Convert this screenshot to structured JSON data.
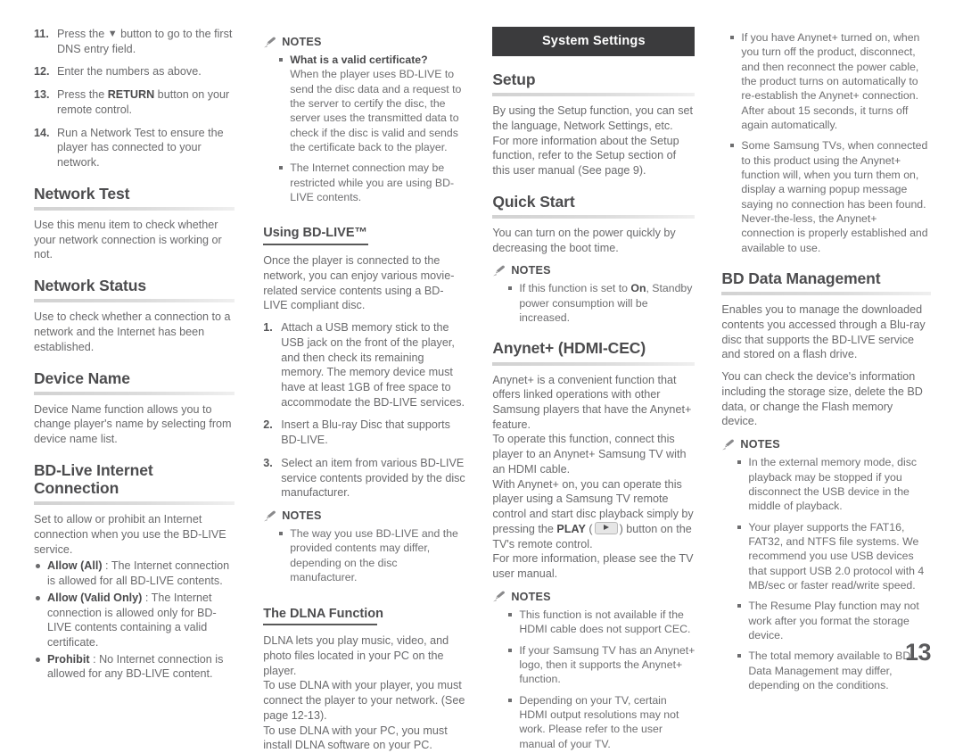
{
  "page": {
    "number": "13",
    "section_bar_label": "System Settings",
    "notes_label": "NOTES"
  },
  "column1": {
    "steps": [
      {
        "num": "11.",
        "text_before": "Press the ",
        "arrow": "▼",
        "text_after": " button to go to the first DNS entry field."
      },
      {
        "num": "12.",
        "text": "Enter the numbers as above."
      },
      {
        "num": "13.",
        "text_before": "Press the ",
        "bold": "RETURN",
        "text_after": " button on your remote control."
      },
      {
        "num": "14.",
        "text": "Run a Network Test to ensure the player has connected to your network."
      }
    ],
    "network_test": {
      "heading": "Network Test",
      "body": "Use this menu item to check whether your network connection is working or not."
    },
    "network_status": {
      "heading": "Network Status",
      "body": "Use to check whether a connection to a network and the Internet has been established."
    },
    "device_name": {
      "heading": "Device Name",
      "body": "Device Name function allows you to change player's name by selecting from device name list."
    },
    "bd_live": {
      "heading": "BD-Live Internet Connection",
      "body": "Set to allow or prohibit an Internet connection when you use the BD-LIVE service.",
      "options": [
        {
          "label": "Allow (All)",
          "text": " : The Internet connection is allowed for all BD-LIVE contents."
        },
        {
          "label": "Allow (Valid Only)",
          "text": " : The Internet connection is allowed only for BD-LIVE contents containing a valid certificate."
        },
        {
          "label": "Prohibit",
          "text": " : No Internet connection is allowed for any BD-LIVE content."
        }
      ]
    }
  },
  "column2": {
    "notes_top": [
      {
        "bold": "What is a valid certificate?",
        "text": "When the player uses BD-LIVE to send the disc data and a request to the server to certify the disc, the server uses the transmitted data to check if the disc is valid and sends the certificate back to the player."
      },
      {
        "text": "The Internet connection may be restricted while you are using BD-LIVE contents."
      }
    ],
    "using_bdlive": {
      "heading": "Using BD-LIVE™",
      "body": "Once the player is connected to the network, you can enjoy various movie-related service contents using a BD-LIVE compliant disc.",
      "steps": [
        {
          "num": "1.",
          "text": "Attach a USB memory stick to the USB jack on the front of the player, and then check its remaining memory. The memory device must have at least 1GB of free space to accommodate the BD-LIVE services."
        },
        {
          "num": "2.",
          "text": "Insert a Blu-ray Disc that supports BD-LIVE."
        },
        {
          "num": "3.",
          "text": "Select an item from various BD-LIVE service contents provided by the disc manufacturer."
        }
      ]
    },
    "notes_mid": [
      {
        "text": "The way you use BD-LIVE and the provided contents may differ, depending on the disc manufacturer."
      }
    ],
    "dlna": {
      "heading": "The DLNA Function",
      "paragraphs": [
        "DLNA lets you play music, video, and photo files located in your PC on the player.",
        "To use DLNA with your player, you must connect the player to your network. (See page 12-13).",
        "To use DLNA with your PC, you must install DLNA software on your PC."
      ]
    }
  },
  "column3": {
    "setup": {
      "heading": "Setup",
      "body": "By using the Setup function, you can set the language, Network Settings, etc.\nFor more information about the Setup function, refer to the Setup section of this user manual (See page 9)."
    },
    "quick_start": {
      "heading": "Quick Start",
      "body": "You can turn on the power quickly by decreasing the boot time.",
      "notes": [
        {
          "text_before": "If this function is set to ",
          "bold": "On",
          "text_after": ", Standby power consumption will be increased."
        }
      ]
    },
    "anynet": {
      "heading": "Anynet+ (HDMI-CEC)",
      "body_part1": "Anynet+ is a convenient function that offers linked operations with other Samsung players that have the Anynet+ feature.\nTo operate this function, connect this player to an Anynet+ Samsung TV with an HDMI cable.\nWith Anynet+ on, you can operate this player using a Samsung TV remote control and start disc playback simply by pressing the ",
      "play_bold": "PLAY",
      "body_part2": " (",
      "play_icon": "play-button-icon",
      "body_part3": ") button on the TV's remote control.\nFor more information, please see the TV user manual.",
      "notes": [
        {
          "text": "This function is not available if the HDMI cable does not support CEC."
        },
        {
          "text": "If your Samsung TV has an Anynet+ logo, then it supports the Anynet+ function."
        },
        {
          "text": "Depending on your TV, certain HDMI output resolutions may not work. Please refer to the user manual of your TV."
        }
      ]
    }
  },
  "column4": {
    "notes_top": [
      {
        "text": "If you have Anynet+ turned on, when you turn off the product, disconnect, and then reconnect the power cable, the product turns on automatically to re-establish the Anynet+ connection. After about 15 seconds, it turns off again automatically."
      },
      {
        "text": "Some Samsung TVs, when connected to this product using the Anynet+ function will, when you turn them on, display a warning popup message saying no connection has been found. Never-the-less, the Anynet+ connection is properly established and available to use."
      }
    ],
    "bd_data_management": {
      "heading": "BD Data Management",
      "paragraphs": [
        "Enables you to manage the downloaded contents you accessed through a Blu-ray disc that supports the BD-LIVE service and stored on a flash drive.",
        "You can check the device's information including the storage size, delete the BD data, or change the Flash memory device."
      ],
      "notes": [
        {
          "text": "In the external memory mode, disc playback may be stopped if you disconnect the USB device in the middle of playback."
        },
        {
          "text": "Your player supports the FAT16, FAT32, and NTFS file systems. We recommend you use USB devices that support USB 2.0 protocol with 4 MB/sec or faster read/write speed."
        },
        {
          "text": "The Resume Play function may not work after you format the storage device."
        },
        {
          "text": "The total memory available to BD Data Management may differ, depending on the conditions."
        }
      ]
    }
  }
}
